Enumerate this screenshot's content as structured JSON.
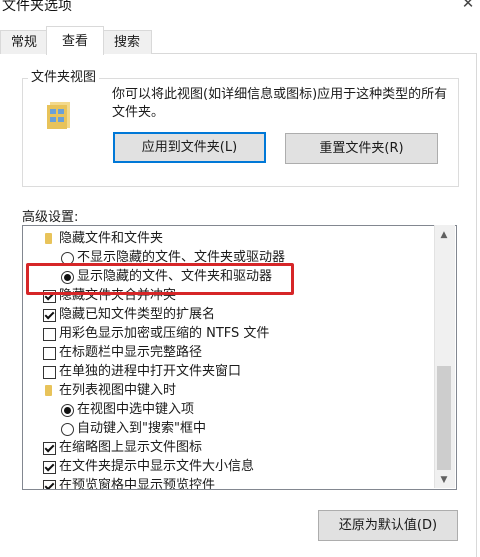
{
  "window": {
    "title": "文件夹选项",
    "close_glyph": "✕"
  },
  "tabs": [
    {
      "label": "常规",
      "selected": false
    },
    {
      "label": "查看",
      "selected": true
    },
    {
      "label": "搜索",
      "selected": false
    }
  ],
  "folder_view": {
    "group_title": "文件夹视图",
    "description": "你可以将此视图(如详细信息或图标)应用于这种类型的所有文件夹。",
    "apply_button": "应用到文件夹(L)",
    "reset_button": "重置文件夹(R)"
  },
  "advanced": {
    "label": "高级设置:",
    "items": [
      {
        "kind": "folder",
        "indent": 0,
        "checked": false,
        "label": "隐藏文件和文件夹"
      },
      {
        "kind": "radio",
        "indent": 1,
        "checked": false,
        "label": "不显示隐藏的文件、文件夹或驱动器"
      },
      {
        "kind": "radio",
        "indent": 1,
        "checked": true,
        "label": "显示隐藏的文件、文件夹和驱动器"
      },
      {
        "kind": "checkbox",
        "indent": 0,
        "checked": true,
        "label": "隐藏文件夹合并冲突"
      },
      {
        "kind": "checkbox",
        "indent": 0,
        "checked": true,
        "label": "隐藏已知文件类型的扩展名"
      },
      {
        "kind": "checkbox",
        "indent": 0,
        "checked": false,
        "label": "用彩色显示加密或压缩的 NTFS 文件"
      },
      {
        "kind": "checkbox",
        "indent": 0,
        "checked": false,
        "label": "在标题栏中显示完整路径"
      },
      {
        "kind": "checkbox",
        "indent": 0,
        "checked": false,
        "label": "在单独的进程中打开文件夹窗口"
      },
      {
        "kind": "folder",
        "indent": 0,
        "checked": false,
        "label": "在列表视图中键入时"
      },
      {
        "kind": "radio",
        "indent": 1,
        "checked": true,
        "label": "在视图中选中键入项"
      },
      {
        "kind": "radio",
        "indent": 1,
        "checked": false,
        "label": "自动键入到\"搜索\"框中"
      },
      {
        "kind": "checkbox",
        "indent": 0,
        "checked": true,
        "label": "在缩略图上显示文件图标"
      },
      {
        "kind": "checkbox",
        "indent": 0,
        "checked": true,
        "label": "在文件夹提示中显示文件大小信息"
      },
      {
        "kind": "checkbox",
        "indent": 0,
        "checked": true,
        "label": "在预览窗格中显示预览控件"
      }
    ],
    "highlight_color": "#d62628"
  },
  "restore_button": "还原为默认值(D)",
  "scrollbar": {
    "up_glyph": "▲",
    "down_glyph": "▼"
  },
  "colors": {
    "accent": "#0078d7",
    "folder": "#e8c35a"
  }
}
